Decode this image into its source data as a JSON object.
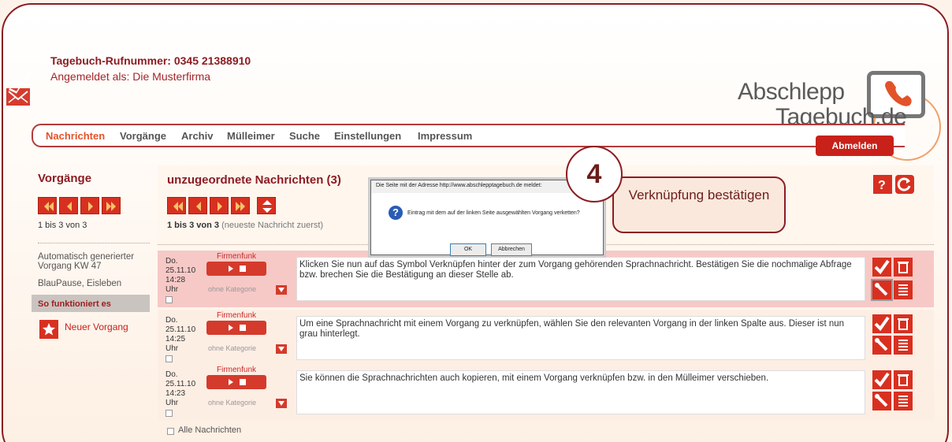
{
  "header": {
    "phone_line": "Tagebuch-Rufnummer: 0345 21388910",
    "login_line": "Angemeldet als: Die Musterfirma"
  },
  "logo": {
    "line1": "Abschlepp",
    "line2": "Tagebuch",
    "tld": ".de"
  },
  "nav": {
    "items": [
      "Nachrichten",
      "Vorgänge",
      "Archiv",
      "Mülleimer",
      "Suche",
      "Einstellungen",
      "Impressum"
    ],
    "active": "Nachrichten",
    "logout_label": "Abmelden"
  },
  "left": {
    "title": "Vorgänge",
    "count": "1 bis 3 von 3",
    "items": [
      "Automatisch generierter Vorgang KW 47",
      "BlauPause, Eisleben",
      "So funktioniert es"
    ],
    "new_label": "Neuer Vorgang"
  },
  "main": {
    "title": "unzugeordnete Nachrichten (3)",
    "count_bold": "1 bis 3 von 3",
    "count_note": "(neueste Nachricht zuerst)",
    "select_all_label": "Alle Nachrichten"
  },
  "messages": [
    {
      "date": "Do. 25.11.10 14:28 Uhr",
      "source": "Firmenfunk",
      "category": "ohne Kategorie",
      "text": "Klicken Sie nun auf das Symbol Verknüpfen hinter der zum Vorgang gehörenden Sprachnachricht. Bestätigen Sie die nochmalige Abfrage bzw. brechen Sie die Bestätigung an dieser Stelle ab."
    },
    {
      "date": "Do. 25.11.10 14:25 Uhr",
      "source": "Firmenfunk",
      "category": "ohne Kategorie",
      "text": "Um eine Sprachnachricht mit einem Vorgang zu verknüpfen, wählen Sie den relevanten Vorgang in der linken Spalte aus. Dieser ist nun grau hinterlegt."
    },
    {
      "date": "Do. 25.11.10 14:23 Uhr",
      "source": "Firmenfunk",
      "category": "ohne Kategorie",
      "text": "Sie können die Sprachnachrichten auch kopieren, mit einem Vorgang verknüpfen bzw. in den Mülleimer verschieben."
    }
  ],
  "dialog": {
    "title": "Die Seite mit der Adresse http://www.abschlepptagebuch.de meldet:",
    "message": "Eintrag mit dem auf der linken Seite ausgewählten Vorgang verketten?",
    "ok_label": "OK",
    "cancel_label": "Abbrechen"
  },
  "annotation": {
    "step": "4",
    "label": "Verknüpfung bestätigen"
  },
  "colors": {
    "brand_red": "#8c1c22",
    "accent_red": "#d83020",
    "active_orange": "#e2532a",
    "highlight_row": "#f7c9c6"
  }
}
